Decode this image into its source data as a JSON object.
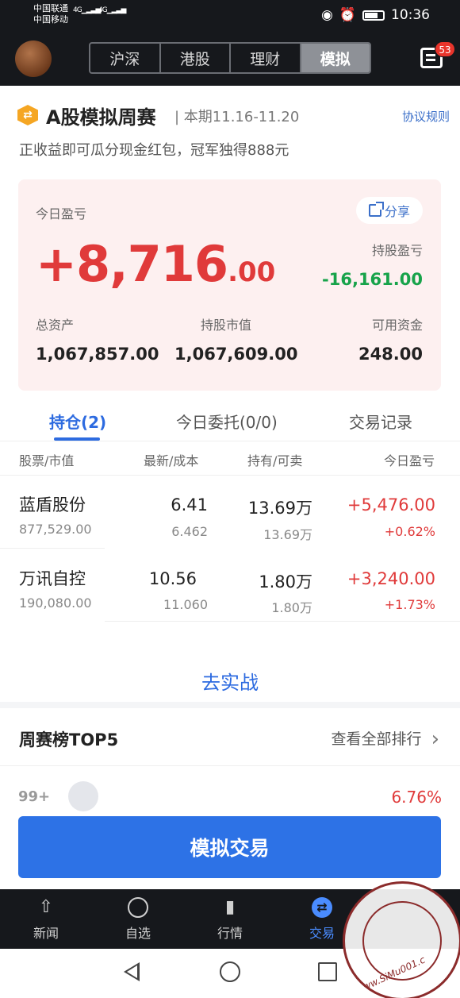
{
  "status_bar": {
    "carrier_1": "中国联通",
    "carrier_2": "中国移动",
    "net_1": "4G",
    "net_2": "4G",
    "time": "10:36"
  },
  "header": {
    "tabs": [
      "沪深",
      "港股",
      "理财",
      "模拟"
    ],
    "active_tab": "模拟",
    "message_badge": "53"
  },
  "contest": {
    "icon_glyph": "⇄",
    "title": "A股模拟周赛",
    "period": "| 本期11.16-11.20",
    "rules_link": "协议规则",
    "subtitle": "正收益即可瓜分现金红包，冠军独得888元"
  },
  "pnl_card": {
    "today_label": "今日盈亏",
    "today_int": "+8,716",
    "today_dec": ".00",
    "share_label": "分享",
    "holding_pnl_label": "持股盈亏",
    "holding_pnl_value": "-16,161.00",
    "total_assets_label": "总资产",
    "total_assets_value": "1,067,857.00",
    "market_value_label": "持股市值",
    "market_value_value": "1,067,609.00",
    "available_cash_label": "可用资金",
    "available_cash_value": "248.00"
  },
  "tabs": {
    "positions": "持仓(2)",
    "orders": "今日委托(0/0)",
    "history": "交易记录"
  },
  "table": {
    "headers": [
      "股票/市值",
      "最新/成本",
      "持有/可卖",
      "今日盈亏"
    ],
    "rows": [
      {
        "name": "蓝盾股份",
        "market_value": "877,529.00",
        "latest": "6.41",
        "cost": "6.462",
        "holding": "13.69万",
        "sellable": "13.69万",
        "pnl": "+5,476.00",
        "pnl_pct": "+0.62%"
      },
      {
        "name": "万讯自控",
        "market_value": "190,080.00",
        "latest": "10.56",
        "cost": "11.060",
        "holding": "1.80万",
        "sellable": "1.80万",
        "pnl": "+3,240.00",
        "pnl_pct": "+1.73%"
      }
    ]
  },
  "go_real": "去实战",
  "ranking": {
    "title": "周赛榜TOP5",
    "view_all": "查看全部排行",
    "chevron": "›",
    "my_position": "99+",
    "my_pct": "6.76%"
  },
  "sim_trade_button": "模拟交易",
  "bottom_nav": [
    {
      "label": "新闻",
      "icon": "news-icon"
    },
    {
      "label": "自选",
      "icon": "watchlist-icon"
    },
    {
      "label": "行情",
      "icon": "market-icon"
    },
    {
      "label": "交易",
      "icon": "trade-icon"
    },
    {
      "label": "",
      "icon": "watermark-hidden"
    }
  ],
  "watermark_text": "www.SiMu001.c"
}
